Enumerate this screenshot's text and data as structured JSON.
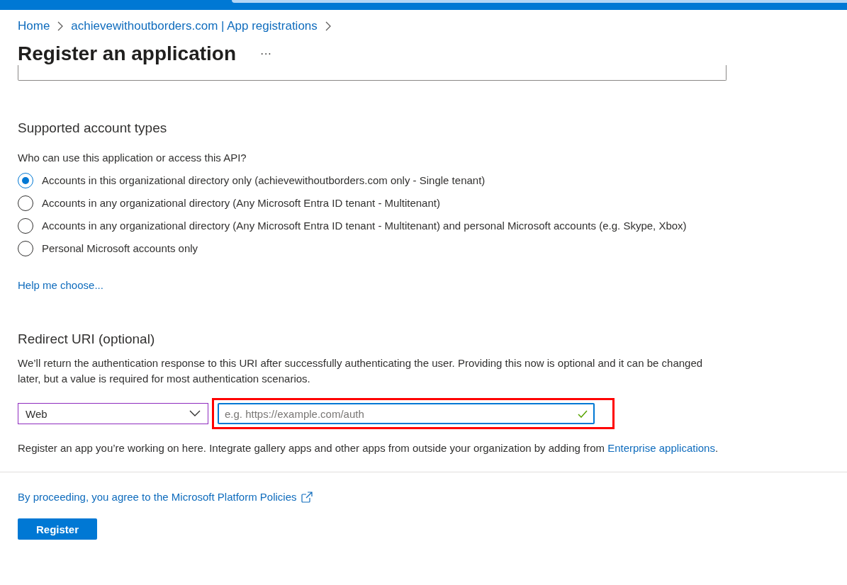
{
  "breadcrumb": [
    {
      "label": "Home"
    },
    {
      "label": "achievewithoutborders.com | App registrations"
    }
  ],
  "page_title": "Register an application",
  "more_menu": "···",
  "account_types": {
    "heading": "Supported account types",
    "question": "Who can use this application or access this API?",
    "options": [
      {
        "label": "Accounts in this organizational directory only (achievewithoutborders.com only - Single tenant)",
        "selected": true
      },
      {
        "label": "Accounts in any organizational directory (Any Microsoft Entra ID tenant - Multitenant)",
        "selected": false
      },
      {
        "label": "Accounts in any organizational directory (Any Microsoft Entra ID tenant - Multitenant) and personal Microsoft accounts (e.g. Skype, Xbox)",
        "selected": false
      },
      {
        "label": "Personal Microsoft accounts only",
        "selected": false
      }
    ],
    "help_link": "Help me choose..."
  },
  "redirect_uri": {
    "heading": "Redirect URI (optional)",
    "description": "We’ll return the authentication response to this URI after successfully authenticating the user. Providing this now is optional and it can be changed later, but a value is required for most authentication scenarios.",
    "platform": "Web",
    "placeholder": "e.g. https://example.com/auth",
    "valid": true,
    "highlighted": true,
    "note": "Register an app you’re working on here. Integrate gallery apps and other apps from outside your organization by adding from",
    "note_link": "Enterprise applications",
    "note_end": "."
  },
  "policy_link": "By proceeding, you agree to the Microsoft Platform Policies",
  "register_button": "Register"
}
